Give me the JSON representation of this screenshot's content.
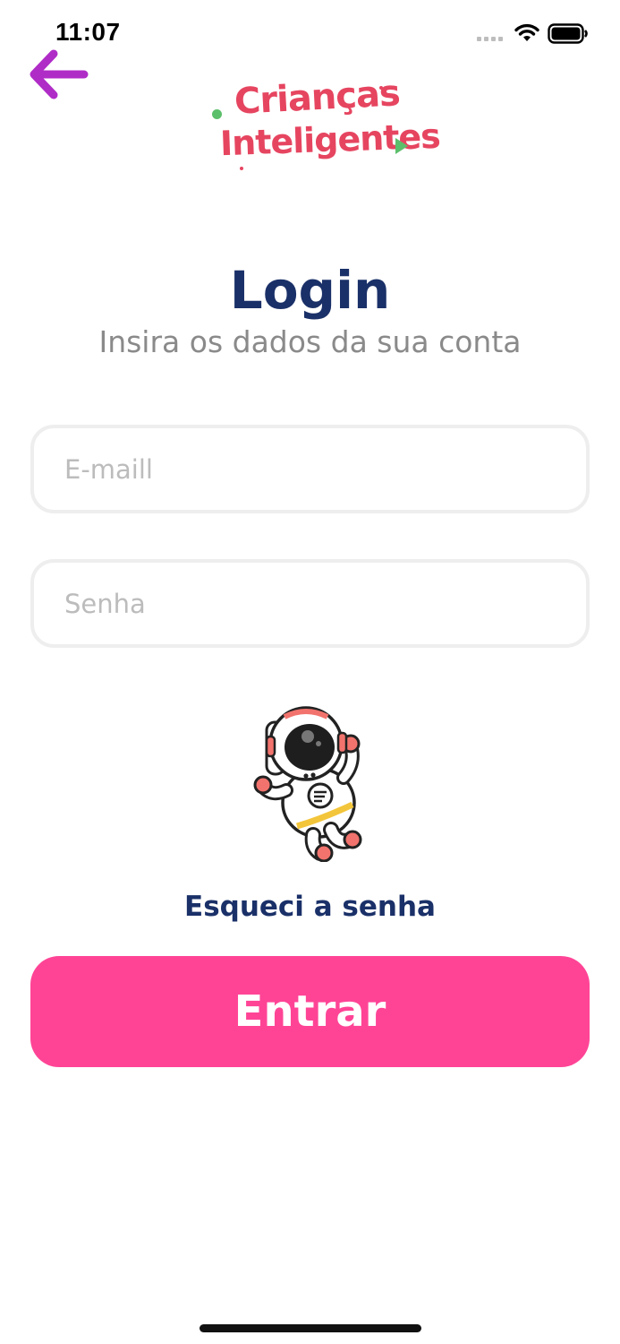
{
  "status_bar": {
    "time": "11:07"
  },
  "app": {
    "logo_line1": "Crianças",
    "logo_line2": "Inteligentes"
  },
  "login": {
    "title": "Login",
    "subtitle": "Insira os dados da sua conta",
    "email_placeholder": "E-maill",
    "email_value": "",
    "password_placeholder": "Senha",
    "password_value": "",
    "forgot_label": "Esqueci a senha",
    "submit_label": "Entrar"
  },
  "icons": {
    "back": "arrow-left-icon",
    "signal": "cellular-signal-icon",
    "wifi": "wifi-icon",
    "battery": "battery-icon",
    "illustration": "astronaut-illustration"
  },
  "colors": {
    "primary": "#ff4496",
    "title": "#1a3068",
    "back_arrow": "#b02cc7",
    "logo_red": "#e64560",
    "logo_green": "#5cbf6b"
  }
}
